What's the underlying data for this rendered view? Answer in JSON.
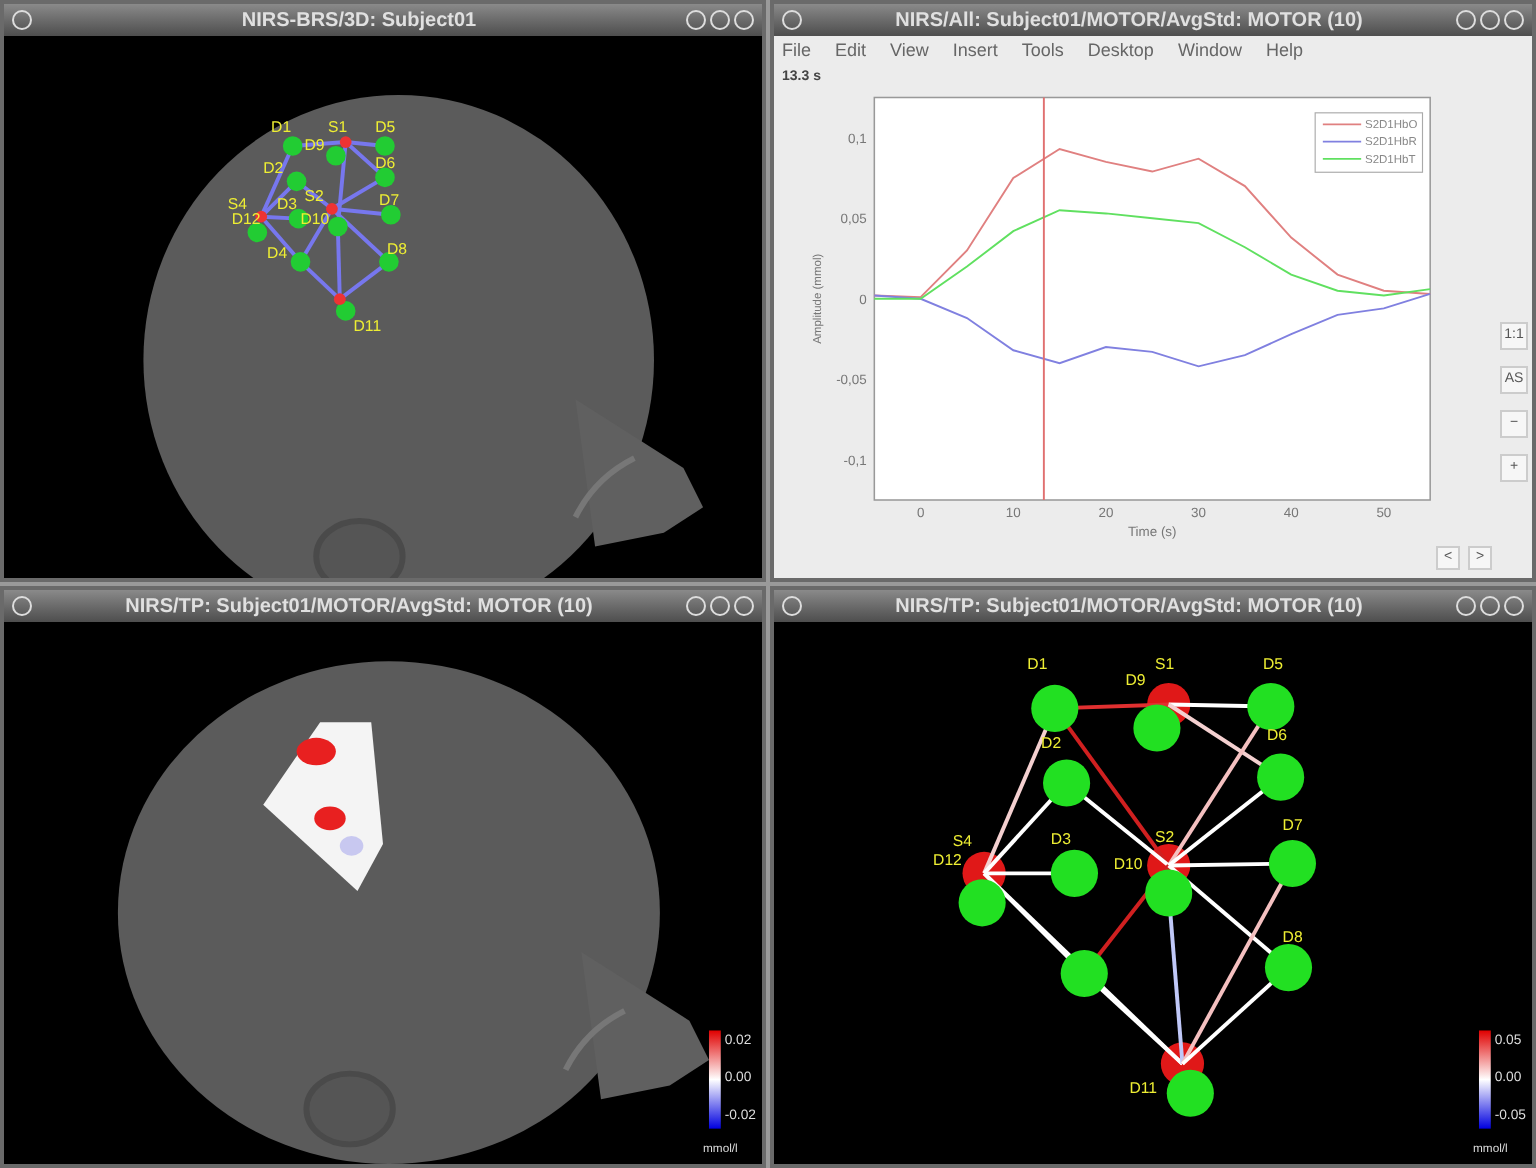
{
  "windows": [
    {
      "kind": "head",
      "title": "NIRS-BRS/3D: Subject01",
      "optodes": [
        "D1",
        "S1",
        "D9",
        "D5",
        "D2",
        "D6",
        "S4",
        "D12",
        "D3",
        "S2",
        "D10",
        "D7",
        "D4",
        "D8",
        "D11"
      ]
    },
    {
      "kind": "figure",
      "title": "NIRS/All: Subject01/MOTOR/AvgStd: MOTOR (10)",
      "menu": [
        "File",
        "Edit",
        "View",
        "Insert",
        "Tools",
        "Desktop",
        "Window",
        "Help"
      ],
      "side_buttons": [
        "1:1",
        "AS",
        "−",
        "+"
      ],
      "nav_buttons": [
        "<",
        ">"
      ],
      "chart_data": {
        "type": "line",
        "xlabel": "Time (s)",
        "ylabel": "Amplitude (mmol)",
        "x": [
          -5,
          0,
          5,
          10,
          15,
          20,
          25,
          30,
          35,
          40,
          45,
          50,
          55
        ],
        "series": [
          {
            "name": "S2D1HbO",
            "color": "#e08080",
            "values": [
              0.002,
              0.001,
              0.03,
              0.075,
              0.093,
              0.085,
              0.079,
              0.087,
              0.07,
              0.038,
              0.015,
              0.005,
              0.003
            ]
          },
          {
            "name": "S2D1HbR",
            "color": "#8080e0",
            "values": [
              0.002,
              0.0,
              -0.012,
              -0.032,
              -0.04,
              -0.03,
              -0.033,
              -0.042,
              -0.035,
              -0.022,
              -0.01,
              -0.006,
              0.003
            ]
          },
          {
            "name": "S2D1HbT",
            "color": "#60e060",
            "values": [
              0.0,
              0.0,
              0.02,
              0.042,
              0.055,
              0.053,
              0.05,
              0.047,
              0.032,
              0.015,
              0.005,
              0.002,
              0.006
            ]
          }
        ],
        "xlim": [
          -5,
          55
        ],
        "ylim": [
          -0.125,
          0.125
        ],
        "xticks": [
          0,
          10,
          20,
          30,
          40,
          50
        ],
        "yticks": [
          {
            "value": 0.1,
            "label": "0,1"
          },
          {
            "value": 0.05,
            "label": "0,05"
          },
          {
            "value": 0,
            "label": "0"
          },
          {
            "value": -0.05,
            "label": "-0,05"
          },
          {
            "value": -0.1,
            "label": "-0,1"
          }
        ],
        "legend": true,
        "ref_lines": [
          {
            "axis": "x",
            "value": 13.3,
            "label": "13.3 s"
          }
        ]
      }
    },
    {
      "kind": "topography",
      "title": "NIRS/TP: Subject01/MOTOR/AvgStd: MOTOR (10)",
      "colorbar": {
        "ticks": [
          "0.02",
          "0.00",
          "-0.02"
        ],
        "unit": "mmol/l"
      }
    },
    {
      "kind": "network",
      "title": "NIRS/TP: Subject01/MOTOR/AvgStd: MOTOR (10)",
      "optodes": [
        "D1",
        "S1",
        "D9",
        "D5",
        "D2",
        "D6",
        "S4",
        "D12",
        "D3",
        "S2",
        "D10",
        "D7",
        "D8",
        "D11"
      ],
      "colorbar": {
        "ticks": [
          "0.05",
          "0.00",
          "-0.05"
        ],
        "unit": "mmol/l"
      }
    }
  ]
}
